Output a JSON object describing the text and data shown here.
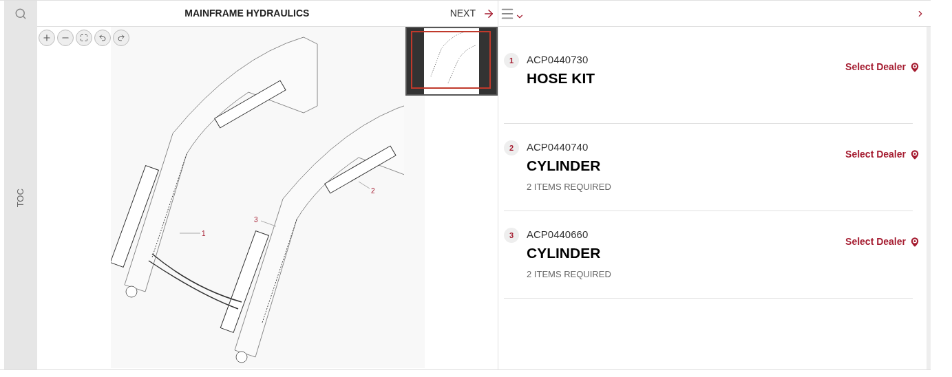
{
  "toc_label": "TOC",
  "header": {
    "title": "MAINFRAME HYDRAULICS",
    "next": "NEXT"
  },
  "diagram": {
    "callouts": [
      "1",
      "2",
      "3"
    ]
  },
  "parts": [
    {
      "index": "1",
      "number": "ACP0440730",
      "name": "HOSE KIT",
      "action": "Select Dealer"
    },
    {
      "index": "2",
      "number": "ACP0440740",
      "name": "CYLINDER",
      "quantity": "2 ITEMS REQUIRED",
      "action": "Select Dealer"
    },
    {
      "index": "3",
      "number": "ACP0440660",
      "name": "CYLINDER",
      "quantity": "2 ITEMS REQUIRED",
      "action": "Select Dealer"
    }
  ]
}
